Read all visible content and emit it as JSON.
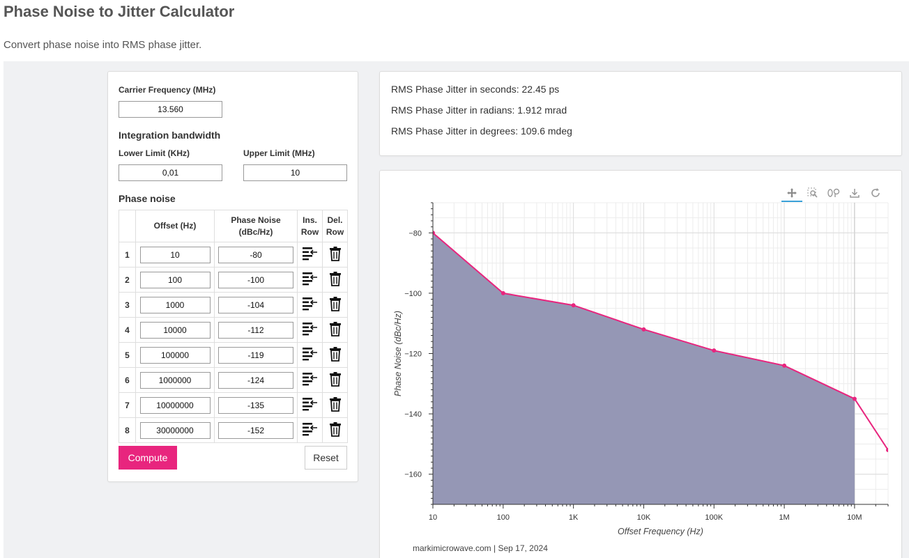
{
  "page": {
    "title": "Phase Noise to Jitter Calculator",
    "subtitle": "Convert phase noise into RMS phase jitter."
  },
  "form": {
    "carrier_label": "Carrier Frequency (MHz)",
    "carrier_value": "13.560",
    "bandwidth_heading": "Integration bandwidth",
    "lower_label": "Lower Limit (KHz)",
    "lower_value": "0,01",
    "upper_label": "Upper Limit (MHz)",
    "upper_value": "10",
    "phase_noise_heading": "Phase noise",
    "table": {
      "col_offset": "Offset (Hz)",
      "col_pn": "Phase Noise (dBc/Hz)",
      "col_ins": "Ins. Row",
      "col_del": "Del. Row",
      "rows": [
        {
          "n": "1",
          "offset": "10",
          "pn": "-80"
        },
        {
          "n": "2",
          "offset": "100",
          "pn": "-100"
        },
        {
          "n": "3",
          "offset": "1000",
          "pn": "-104"
        },
        {
          "n": "4",
          "offset": "10000",
          "pn": "-112"
        },
        {
          "n": "5",
          "offset": "100000",
          "pn": "-119"
        },
        {
          "n": "6",
          "offset": "1000000",
          "pn": "-124"
        },
        {
          "n": "7",
          "offset": "10000000",
          "pn": "-135"
        },
        {
          "n": "8",
          "offset": "30000000",
          "pn": "-152"
        }
      ]
    },
    "compute_label": "Compute",
    "reset_label": "Reset"
  },
  "results": {
    "seconds": "RMS Phase Jitter in seconds: 22.45 ps",
    "radians": "RMS Phase Jitter in radians: 1.912 mrad",
    "degrees": "RMS Phase Jitter in degrees: 109.6 mdeg"
  },
  "modebar": {
    "icons": [
      "pan-icon",
      "zoom-icon",
      "autoscale-icon",
      "download-icon",
      "reset-icon"
    ]
  },
  "chart_data": {
    "type": "line",
    "x_scale": "log",
    "x": [
      10,
      100,
      1000,
      10000,
      100000,
      1000000,
      10000000,
      30000000
    ],
    "y": [
      -80,
      -100,
      -104,
      -112,
      -119,
      -124,
      -135,
      -152
    ],
    "fill_range": [
      10,
      10000000
    ],
    "xlabel": "Offset Frequency (Hz)",
    "ylabel": "Phase Noise (dBc/Hz)",
    "x_ticks": [
      "10",
      "100",
      "1K",
      "10K",
      "100K",
      "1M",
      "10M"
    ],
    "y_ticks": [
      "−80",
      "−100",
      "−120",
      "−140",
      "−160"
    ],
    "y_tick_values": [
      -80,
      -100,
      -120,
      -140,
      -160
    ],
    "xlim": [
      10,
      30000000
    ],
    "ylim": [
      -170,
      -70
    ],
    "grid": true,
    "line_color": "#e8257e",
    "fill_color": "#9597b5",
    "footer": "markimicrowave.com | Sep 17, 2024"
  }
}
